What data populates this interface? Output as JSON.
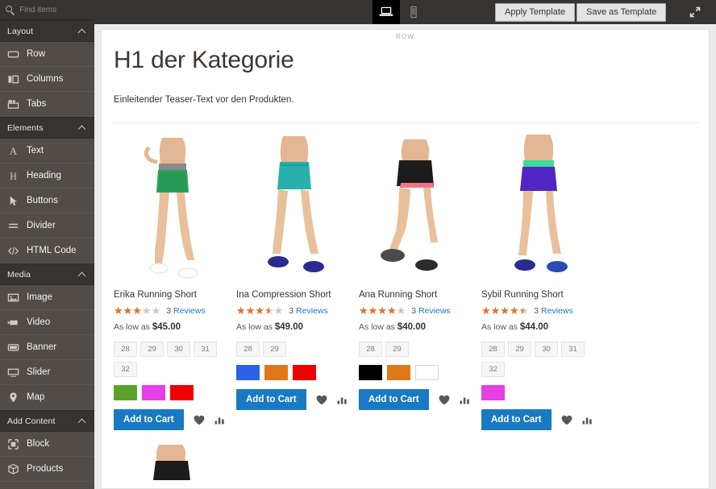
{
  "sidebar": {
    "search": {
      "placeholder": "Find items",
      "value": "",
      "icon": "search-icon"
    },
    "sections": [
      {
        "title": "Layout",
        "chevron": "chevron-up-icon",
        "items": [
          {
            "label": "Row",
            "icon": "row-icon"
          },
          {
            "label": "Columns",
            "icon": "columns-icon"
          },
          {
            "label": "Tabs",
            "icon": "tabs-icon"
          }
        ]
      },
      {
        "title": "Elements",
        "chevron": "chevron-up-icon",
        "items": [
          {
            "label": "Text",
            "icon": "text-icon"
          },
          {
            "label": "Heading",
            "icon": "heading-icon"
          },
          {
            "label": "Buttons",
            "icon": "buttons-icon"
          },
          {
            "label": "Divider",
            "icon": "divider-icon"
          },
          {
            "label": "HTML Code",
            "icon": "html-code-icon"
          }
        ]
      },
      {
        "title": "Media",
        "chevron": "chevron-up-icon",
        "items": [
          {
            "label": "Image",
            "icon": "image-icon"
          },
          {
            "label": "Video",
            "icon": "video-icon"
          },
          {
            "label": "Banner",
            "icon": "banner-icon"
          },
          {
            "label": "Slider",
            "icon": "slider-icon"
          },
          {
            "label": "Map",
            "icon": "map-pin-icon"
          }
        ]
      },
      {
        "title": "Add Content",
        "chevron": "chevron-up-icon",
        "items": [
          {
            "label": "Block",
            "icon": "block-icon"
          },
          {
            "label": "Products",
            "icon": "products-icon"
          }
        ]
      }
    ]
  },
  "topbar": {
    "viewports": [
      {
        "name": "desktop",
        "icon": "laptop-icon",
        "active": true
      },
      {
        "name": "mobile",
        "icon": "mobile-icon",
        "active": false
      }
    ],
    "apply_template_label": "Apply Template",
    "save_as_template_label": "Save as Template",
    "expand_icon": "expand-icon"
  },
  "canvas": {
    "row_label": "ROW",
    "heading": "H1 der Kategorie",
    "teaser": "Einleitender Teaser-Text vor den Produkten.",
    "products": [
      {
        "name": "Erika Running Short",
        "rating_pct": 60,
        "reviews_count": "3",
        "reviews_label": "Reviews",
        "price_prefix": "As low as",
        "price": "$45.00",
        "sizes": [
          "28",
          "29",
          "30",
          "31",
          "32"
        ],
        "colors": [
          "#5aa32a",
          "#e53fe5",
          "#ee0000"
        ],
        "add_to_cart_label": "Add to Cart",
        "wishlist_icon": "heart-icon",
        "compare_icon": "compare-icon",
        "image": "green-running-short"
      },
      {
        "name": "Ina Compression Short",
        "rating_pct": 70,
        "reviews_count": "3",
        "reviews_label": "Reviews",
        "price_prefix": "As low as",
        "price": "$49.00",
        "sizes": [
          "28",
          "29"
        ],
        "colors": [
          "#2b61e8",
          "#e07818",
          "#ee0000"
        ],
        "add_to_cart_label": "Add to Cart",
        "wishlist_icon": "heart-icon",
        "compare_icon": "compare-icon",
        "image": "teal-compression-short"
      },
      {
        "name": "Ana Running Short",
        "rating_pct": 80,
        "reviews_count": "3",
        "reviews_label": "Reviews",
        "price_prefix": "As low as",
        "price": "$40.00",
        "sizes": [
          "28",
          "29"
        ],
        "colors": [
          "#000000",
          "#e07818",
          "#ffffff"
        ],
        "add_to_cart_label": "Add to Cart",
        "wishlist_icon": "heart-icon",
        "compare_icon": "compare-icon",
        "image": "black-running-short"
      },
      {
        "name": "Sybil Running Short",
        "rating_pct": 90,
        "reviews_count": "3",
        "reviews_label": "Reviews",
        "price_prefix": "As low as",
        "price": "$44.00",
        "sizes": [
          "28",
          "29",
          "30",
          "31",
          "32"
        ],
        "colors": [
          "#e53fe5"
        ],
        "add_to_cart_label": "Add to Cart",
        "wishlist_icon": "heart-icon",
        "compare_icon": "compare-icon",
        "image": "purple-running-short"
      }
    ]
  },
  "colors": {
    "sidebar_bg": "#514c48",
    "sidebar_head_bg": "#373330",
    "accent_blue": "#1979c3",
    "star_orange": "#ec6f20",
    "link_blue": "#1979c3"
  }
}
